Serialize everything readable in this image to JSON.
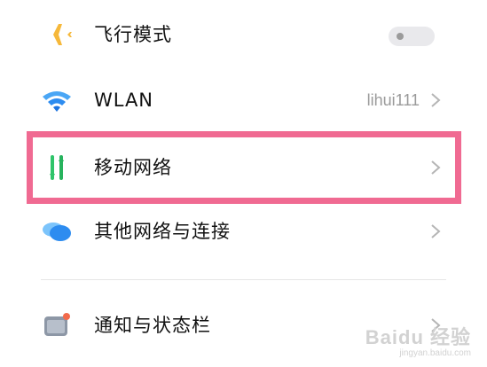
{
  "settings": {
    "items": [
      {
        "label": "飞行模式",
        "icon": "airplane-icon",
        "control": "toggle",
        "toggle_on": false
      },
      {
        "label": "WLAN",
        "icon": "wifi-icon",
        "value": "lihui111",
        "control": "chevron"
      },
      {
        "label": "移动网络",
        "icon": "mobile-data-icon",
        "control": "chevron",
        "highlighted": true
      },
      {
        "label": "其他网络与连接",
        "icon": "cloud-icon",
        "control": "chevron"
      },
      {
        "label": "通知与状态栏",
        "icon": "notification-icon",
        "control": "chevron"
      }
    ]
  },
  "colors": {
    "highlight_border": "#f06a92",
    "airplane": "#f6b83a",
    "wifi": "#2d8cf0",
    "mobile_up": "#2fc46a",
    "mobile_down": "#2fc46a",
    "cloud": "#3aa0f5",
    "notify_badge": "#f26a4b"
  },
  "watermark": {
    "main": "Baidu 经验",
    "sub": "jingyan.baidu.com"
  }
}
